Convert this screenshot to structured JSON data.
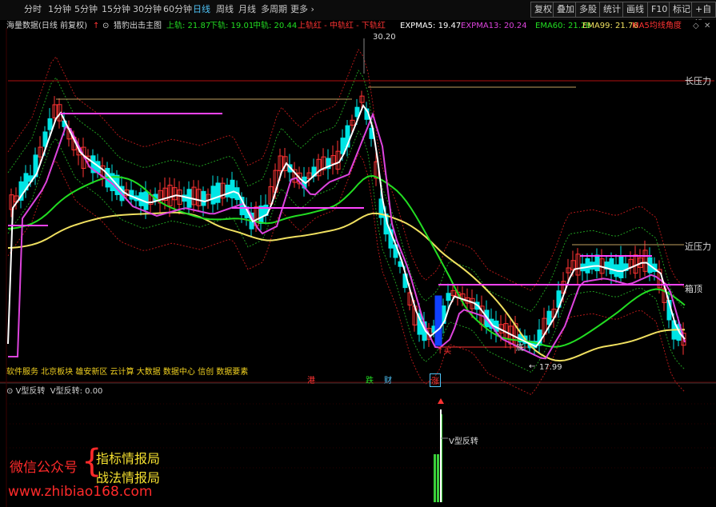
{
  "toolbar": {
    "periods": [
      "分时",
      "1分钟",
      "5分钟",
      "15分钟",
      "30分钟",
      "60分钟",
      "日线",
      "周线",
      "月线",
      "多周期",
      "更多 ›"
    ],
    "active_period": "日线",
    "right_buttons": [
      "复权",
      "叠加",
      "多股",
      "统计",
      "画线",
      "F10",
      "标记",
      "+自选"
    ]
  },
  "main_header": {
    "stock_name": "海量数据(日线 前复权)",
    "indicator_name": "猎豹出击主图",
    "items": [
      {
        "text": "上轨: 21.87",
        "color": "#22dd22"
      },
      {
        "text": "下轨: 19.01",
        "color": "#22dd22"
      },
      {
        "text": "中轨: 20.44",
        "color": "#22dd22"
      },
      {
        "text": "上轨红 - 中轨红 - 下轨红",
        "color": "#ff3333"
      },
      {
        "text": "EXPMA5: 19.47",
        "color": "#ffffff"
      },
      {
        "text": "EXPMA13: 20.24",
        "color": "#dd44dd"
      },
      {
        "text": "EMA60: 21.28",
        "color": "#22dd22"
      },
      {
        "text": "EMA99: 21.76",
        "color": "#f0e060"
      },
      {
        "text": "MA5均线角度",
        "color": "#ff3333"
      }
    ]
  },
  "price_labels": {
    "high": "30.20",
    "low": "17.99"
  },
  "level_labels": {
    "long_pressure": "长压力",
    "near_pressure": "近压力",
    "box_top": "箱顶"
  },
  "signal_labels": {
    "buy": "↑买",
    "bottom": "底",
    "reversal": "V型反转"
  },
  "scrolling_text": "软件服务 北京板块 雄安新区 云计算 大数据 数据中心 信创 数据要素",
  "event_markers": [
    {
      "text": "港",
      "color": "#ff3333"
    },
    {
      "text": "跌",
      "color": "#22dd22"
    },
    {
      "text": "财",
      "color": "#4fc3f7"
    },
    {
      "text": "涨",
      "color": "#ff3333"
    }
  ],
  "sub_header": {
    "name": "V型反转",
    "value_text": "V型反转: 0.00"
  },
  "watermark": {
    "line1": "微信公众号",
    "line2": "指标情报局",
    "line3": "战法情报局",
    "url": "www.zhibiao168.com"
  },
  "colors": {
    "up": "#ff3333",
    "down": "#00e5e5",
    "ma5": "#ffffff",
    "ma13": "#dd44dd",
    "ema60": "#22dd22",
    "ema99": "#f0e060",
    "box": "#ff44ff"
  }
}
